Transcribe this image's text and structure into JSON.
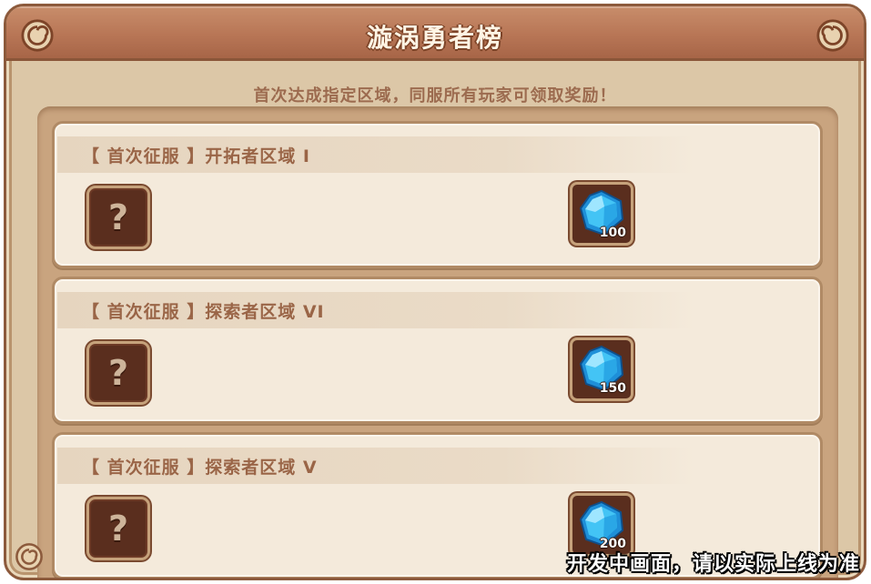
{
  "panel": {
    "title": "漩涡勇者榜",
    "subtitle": "首次达成指定区域，同服所有玩家可领取奖励！"
  },
  "rows": [
    {
      "title": "【 首次征服 】开拓者区域 I",
      "locked_symbol": "?",
      "reward": {
        "icon": "blue-gem-icon",
        "quantity": "100"
      }
    },
    {
      "title": "【 首次征服 】探索者区域 VI",
      "locked_symbol": "?",
      "reward": {
        "icon": "blue-gem-icon",
        "quantity": "150"
      }
    },
    {
      "title": "【 首次征服 】探索者区域 V",
      "locked_symbol": "?",
      "reward": {
        "icon": "blue-gem-icon",
        "quantity": "200"
      }
    }
  ],
  "overlay": {
    "dev_note": "开发中画面，请以实际上线为准"
  },
  "colors": {
    "title_bar": "#b87656",
    "panel_bg": "#dcc7a7",
    "row_bg": "#f4eadb",
    "slot_bg": "#5a2e1e",
    "gem": "#2fb6f0"
  }
}
